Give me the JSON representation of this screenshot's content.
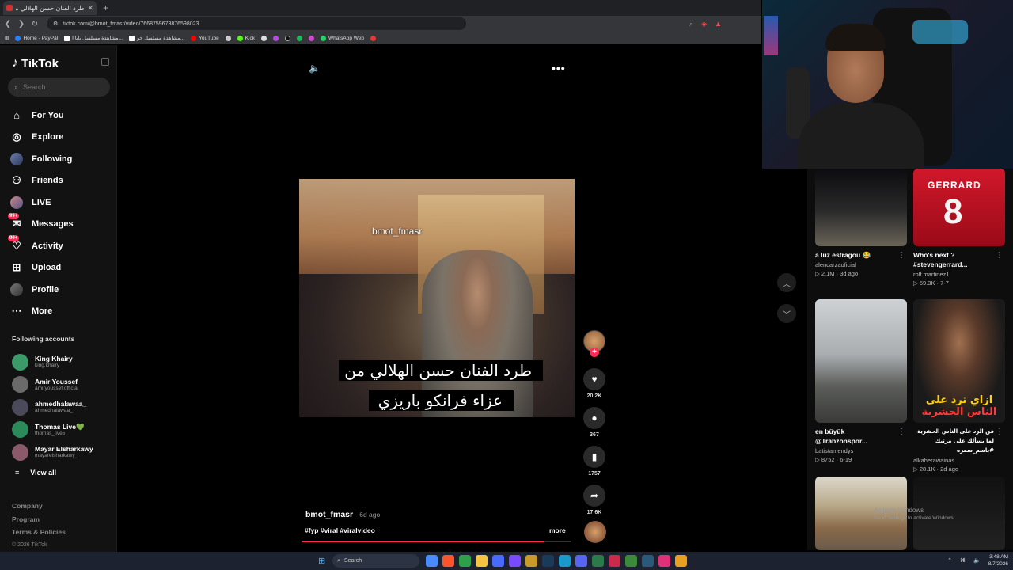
{
  "browser": {
    "tab_title": "طرد الفنان حسن الهلالي من عز",
    "url": "tiktok.com/@bmot_fmasr/video/7668759673876598023",
    "bookmarks": [
      "Home - PayPal",
      "مشاهدة مسلسل بابا ا...",
      "مشاهدة مسلسل جو...",
      "YouTube",
      "Kick",
      "WhatsApp Web"
    ]
  },
  "sidebar": {
    "logo": "TikTok",
    "search_placeholder": "Search",
    "nav": [
      {
        "label": "For You",
        "icon": "home-icon"
      },
      {
        "label": "Explore",
        "icon": "compass-icon"
      },
      {
        "label": "Following",
        "icon": "following-avatar-icon"
      },
      {
        "label": "Friends",
        "icon": "friends-icon"
      },
      {
        "label": "LIVE",
        "icon": "live-icon"
      },
      {
        "label": "Messages",
        "icon": "messages-icon",
        "badge": "99+"
      },
      {
        "label": "Activity",
        "icon": "activity-icon",
        "badge": "99+"
      },
      {
        "label": "Upload",
        "icon": "upload-icon"
      },
      {
        "label": "Profile",
        "icon": "profile-icon"
      },
      {
        "label": "More",
        "icon": "more-icon"
      }
    ],
    "following_title": "Following accounts",
    "following": [
      {
        "name": "King Khairy",
        "handle": "king.khairy",
        "color": "#3a9a6a"
      },
      {
        "name": "Amir Youssef",
        "handle": "amiryoussef.official",
        "color": "#6a6a6a"
      },
      {
        "name": "ahmedhalawaa_",
        "handle": "ahmedhalawaa_",
        "color": "#4a4a5a"
      },
      {
        "name": "Thomas Live💚",
        "handle": "thomas_live5",
        "color": "#2a8a5a"
      },
      {
        "name": "Mayar Elsharkawy",
        "handle": "mayarelsharkawy_",
        "color": "#8a5a6a"
      }
    ],
    "view_all": "View all",
    "footer": [
      "Company",
      "Program",
      "Terms & Policies"
    ],
    "copyright": "© 2026 TikTok"
  },
  "video": {
    "watermark": "bmot_fmasr",
    "caption_line1": "طرد الفنان حسن الهلالي من",
    "caption_line2": "عزاء فرانكو باريزي",
    "author": "bmot_fmasr",
    "age": "· 6d ago",
    "hashtags": "#fyp #viral #viralvideo",
    "more_label": "more",
    "progress": 0.9,
    "likes": "20.2K",
    "comments": "367",
    "saves": "1757",
    "shares": "17.6K"
  },
  "recommended": [
    {
      "title": "a luz estragou 😂",
      "user": "alencarzaoficial",
      "stats": "▷ 2.1M · 3d ago"
    },
    {
      "title": "Who's next ? #stevengerrard...",
      "user": "rolf.martinez1",
      "stats": "▷ 59.3K · 7-7",
      "shirt_name": "GERRARD",
      "shirt_number": "8"
    },
    {
      "title": "en büyük @Trabzonspor...",
      "user": "batistamendys",
      "stats": "▷ 8752 · 6-19"
    },
    {
      "title": "فن الرد على الناس الحشرية لما يسألك على مرتبك #باسم_سمره",
      "user": "alkaherawainas",
      "stats": "▷ 28.1K · 2d ago",
      "overlay_1": "ازاي ترد على",
      "overlay_2": "الناس الحشرية"
    }
  ],
  "windows_watermark": {
    "line1": "Activate Windows",
    "line2": "Go to Settings to activate Windows."
  },
  "taskbar": {
    "search": "Search",
    "time": "3:48 AM",
    "date": "8/7/2026"
  }
}
